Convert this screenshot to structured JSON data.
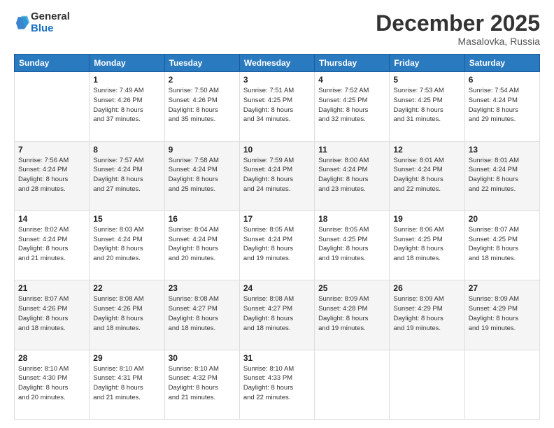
{
  "logo": {
    "general": "General",
    "blue": "Blue"
  },
  "title": "December 2025",
  "location": "Masalovka, Russia",
  "days_of_week": [
    "Sunday",
    "Monday",
    "Tuesday",
    "Wednesday",
    "Thursday",
    "Friday",
    "Saturday"
  ],
  "weeks": [
    [
      {
        "day": "",
        "info": ""
      },
      {
        "day": "1",
        "info": "Sunrise: 7:49 AM\nSunset: 4:26 PM\nDaylight: 8 hours\nand 37 minutes."
      },
      {
        "day": "2",
        "info": "Sunrise: 7:50 AM\nSunset: 4:26 PM\nDaylight: 8 hours\nand 35 minutes."
      },
      {
        "day": "3",
        "info": "Sunrise: 7:51 AM\nSunset: 4:25 PM\nDaylight: 8 hours\nand 34 minutes."
      },
      {
        "day": "4",
        "info": "Sunrise: 7:52 AM\nSunset: 4:25 PM\nDaylight: 8 hours\nand 32 minutes."
      },
      {
        "day": "5",
        "info": "Sunrise: 7:53 AM\nSunset: 4:25 PM\nDaylight: 8 hours\nand 31 minutes."
      },
      {
        "day": "6",
        "info": "Sunrise: 7:54 AM\nSunset: 4:24 PM\nDaylight: 8 hours\nand 29 minutes."
      }
    ],
    [
      {
        "day": "7",
        "info": "Sunrise: 7:56 AM\nSunset: 4:24 PM\nDaylight: 8 hours\nand 28 minutes."
      },
      {
        "day": "8",
        "info": "Sunrise: 7:57 AM\nSunset: 4:24 PM\nDaylight: 8 hours\nand 27 minutes."
      },
      {
        "day": "9",
        "info": "Sunrise: 7:58 AM\nSunset: 4:24 PM\nDaylight: 8 hours\nand 25 minutes."
      },
      {
        "day": "10",
        "info": "Sunrise: 7:59 AM\nSunset: 4:24 PM\nDaylight: 8 hours\nand 24 minutes."
      },
      {
        "day": "11",
        "info": "Sunrise: 8:00 AM\nSunset: 4:24 PM\nDaylight: 8 hours\nand 23 minutes."
      },
      {
        "day": "12",
        "info": "Sunrise: 8:01 AM\nSunset: 4:24 PM\nDaylight: 8 hours\nand 22 minutes."
      },
      {
        "day": "13",
        "info": "Sunrise: 8:01 AM\nSunset: 4:24 PM\nDaylight: 8 hours\nand 22 minutes."
      }
    ],
    [
      {
        "day": "14",
        "info": "Sunrise: 8:02 AM\nSunset: 4:24 PM\nDaylight: 8 hours\nand 21 minutes."
      },
      {
        "day": "15",
        "info": "Sunrise: 8:03 AM\nSunset: 4:24 PM\nDaylight: 8 hours\nand 20 minutes."
      },
      {
        "day": "16",
        "info": "Sunrise: 8:04 AM\nSunset: 4:24 PM\nDaylight: 8 hours\nand 20 minutes."
      },
      {
        "day": "17",
        "info": "Sunrise: 8:05 AM\nSunset: 4:24 PM\nDaylight: 8 hours\nand 19 minutes."
      },
      {
        "day": "18",
        "info": "Sunrise: 8:05 AM\nSunset: 4:25 PM\nDaylight: 8 hours\nand 19 minutes."
      },
      {
        "day": "19",
        "info": "Sunrise: 8:06 AM\nSunset: 4:25 PM\nDaylight: 8 hours\nand 18 minutes."
      },
      {
        "day": "20",
        "info": "Sunrise: 8:07 AM\nSunset: 4:25 PM\nDaylight: 8 hours\nand 18 minutes."
      }
    ],
    [
      {
        "day": "21",
        "info": "Sunrise: 8:07 AM\nSunset: 4:26 PM\nDaylight: 8 hours\nand 18 minutes."
      },
      {
        "day": "22",
        "info": "Sunrise: 8:08 AM\nSunset: 4:26 PM\nDaylight: 8 hours\nand 18 minutes."
      },
      {
        "day": "23",
        "info": "Sunrise: 8:08 AM\nSunset: 4:27 PM\nDaylight: 8 hours\nand 18 minutes."
      },
      {
        "day": "24",
        "info": "Sunrise: 8:08 AM\nSunset: 4:27 PM\nDaylight: 8 hours\nand 18 minutes."
      },
      {
        "day": "25",
        "info": "Sunrise: 8:09 AM\nSunset: 4:28 PM\nDaylight: 8 hours\nand 19 minutes."
      },
      {
        "day": "26",
        "info": "Sunrise: 8:09 AM\nSunset: 4:29 PM\nDaylight: 8 hours\nand 19 minutes."
      },
      {
        "day": "27",
        "info": "Sunrise: 8:09 AM\nSunset: 4:29 PM\nDaylight: 8 hours\nand 19 minutes."
      }
    ],
    [
      {
        "day": "28",
        "info": "Sunrise: 8:10 AM\nSunset: 4:30 PM\nDaylight: 8 hours\nand 20 minutes."
      },
      {
        "day": "29",
        "info": "Sunrise: 8:10 AM\nSunset: 4:31 PM\nDaylight: 8 hours\nand 21 minutes."
      },
      {
        "day": "30",
        "info": "Sunrise: 8:10 AM\nSunset: 4:32 PM\nDaylight: 8 hours\nand 21 minutes."
      },
      {
        "day": "31",
        "info": "Sunrise: 8:10 AM\nSunset: 4:33 PM\nDaylight: 8 hours\nand 22 minutes."
      },
      {
        "day": "",
        "info": ""
      },
      {
        "day": "",
        "info": ""
      },
      {
        "day": "",
        "info": ""
      }
    ]
  ]
}
